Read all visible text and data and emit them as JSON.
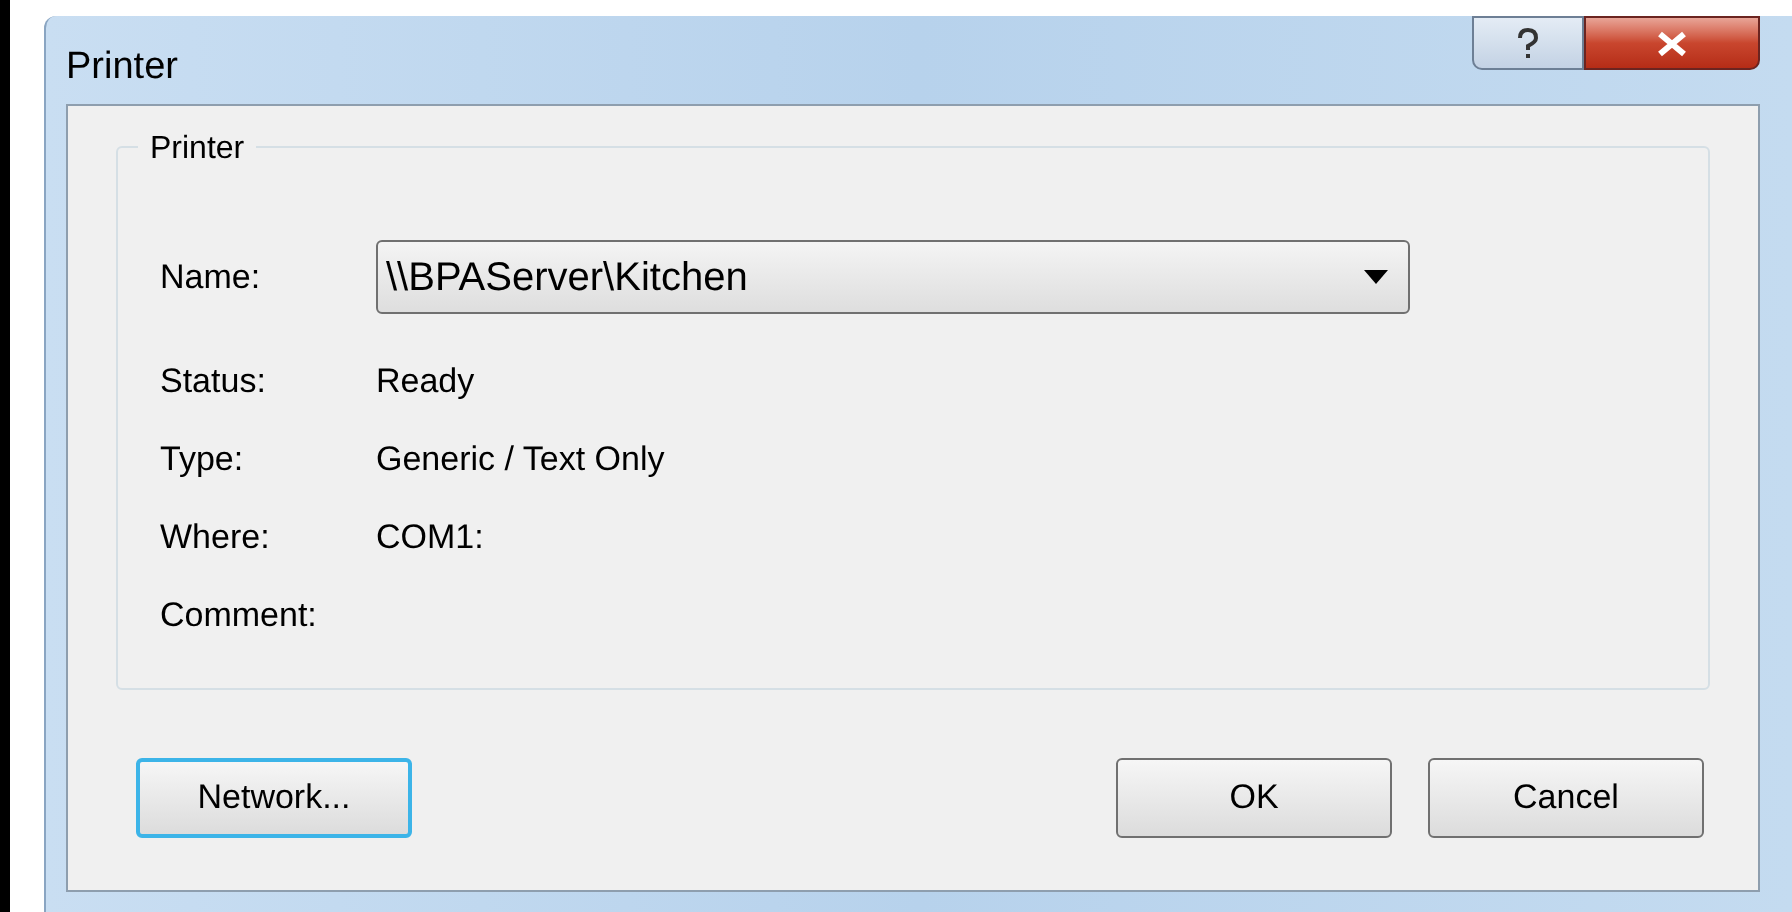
{
  "window": {
    "title": "Printer"
  },
  "group": {
    "title": "Printer"
  },
  "name_field": {
    "label": "Name:",
    "value": "\\\\BPAServer\\Kitchen"
  },
  "info": [
    {
      "label": "Status:",
      "value": "Ready"
    },
    {
      "label": "Type:",
      "value": "Generic / Text Only"
    },
    {
      "label": "Where:",
      "value": "COM1:"
    },
    {
      "label": "Comment:"
    }
  ],
  "buttons": [
    {
      "label": "Network...",
      "focused": true
    },
    {
      "label": "OK",
      "focused": false
    },
    {
      "label": "Cancel",
      "focused": false
    }
  ]
}
